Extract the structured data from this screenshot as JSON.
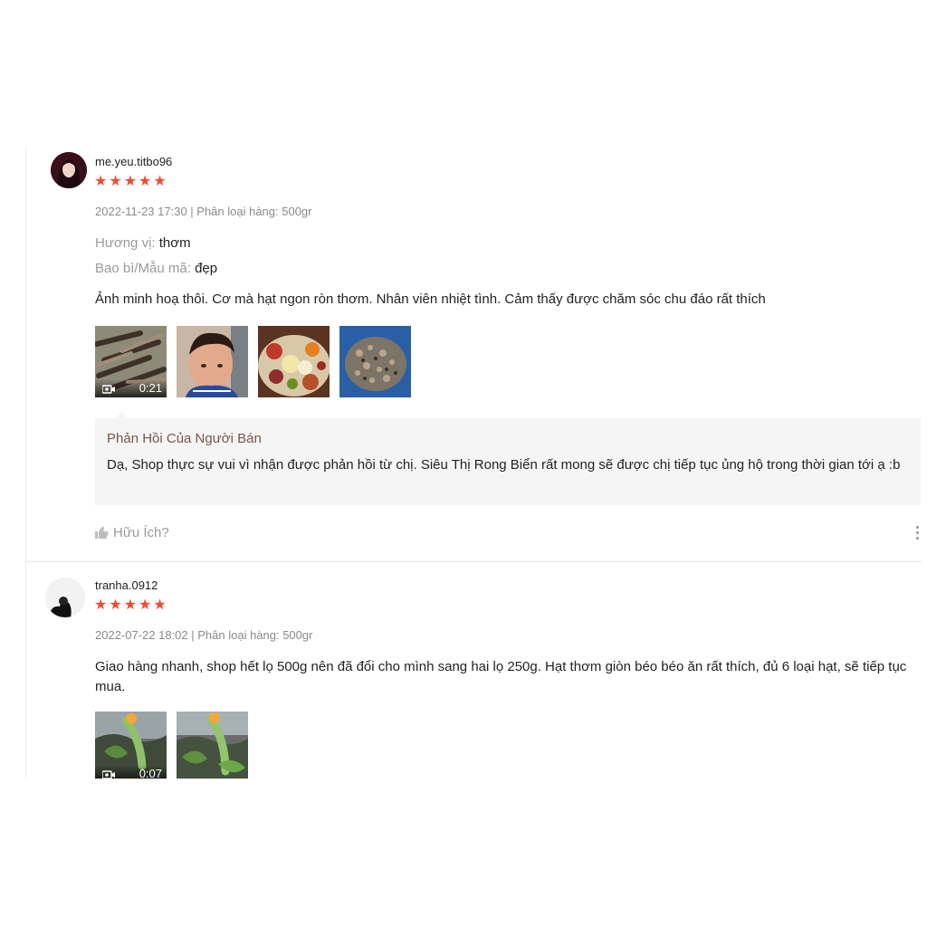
{
  "colors": {
    "star": "#ee4d2d",
    "reply_title": "#795548",
    "muted": "#8a8a8a"
  },
  "reviews": [
    {
      "username": "me.yeu.titbo96",
      "rating": 5,
      "meta": "2022-11-23 17:30 | Phân loại hàng: 500gr",
      "attributes": [
        {
          "key": "Hương vị:",
          "value": "thơm"
        },
        {
          "key": "Bao bì/Mẫu mã:",
          "value": "đẹp"
        }
      ],
      "comment": "Ảnh minh hoạ thôi. Cơ mà hạt ngon ròn thơm. Nhân viên nhiệt tình. Cảm thấy được chăm sóc chu đáo rất thích",
      "media": [
        {
          "type": "video",
          "duration": "0:21",
          "icon": "video-camera-icon"
        },
        {
          "type": "image"
        },
        {
          "type": "image"
        },
        {
          "type": "image"
        }
      ],
      "seller_reply": {
        "title": "Phản Hồi Của Người Bán",
        "text": "Dạ, Shop thực sự vui vì nhận được phản hồi từ chị. Siêu Thị Rong Biển rất mong sẽ được chị tiếp tục ủng hộ trong thời gian tới ạ :b"
      },
      "helpful_label": "Hữu Ích?",
      "helpful_icon": "thumbs-up-icon",
      "more_icon": "more-vertical-icon"
    },
    {
      "username": "tranha.0912",
      "rating": 5,
      "meta": "2022-07-22 18:02 | Phân loại hàng: 500gr",
      "comment": "Giao hàng nhanh, shop hết lọ 500g nên đã đổi cho mình sang hai lọ 250g. Hạt thơm giòn béo béo ăn rất thích, đủ 6 loại hạt, sẽ tiếp tục mua.",
      "media": [
        {
          "type": "video",
          "duration": "0:07",
          "icon": "video-camera-icon"
        },
        {
          "type": "image"
        }
      ]
    }
  ]
}
